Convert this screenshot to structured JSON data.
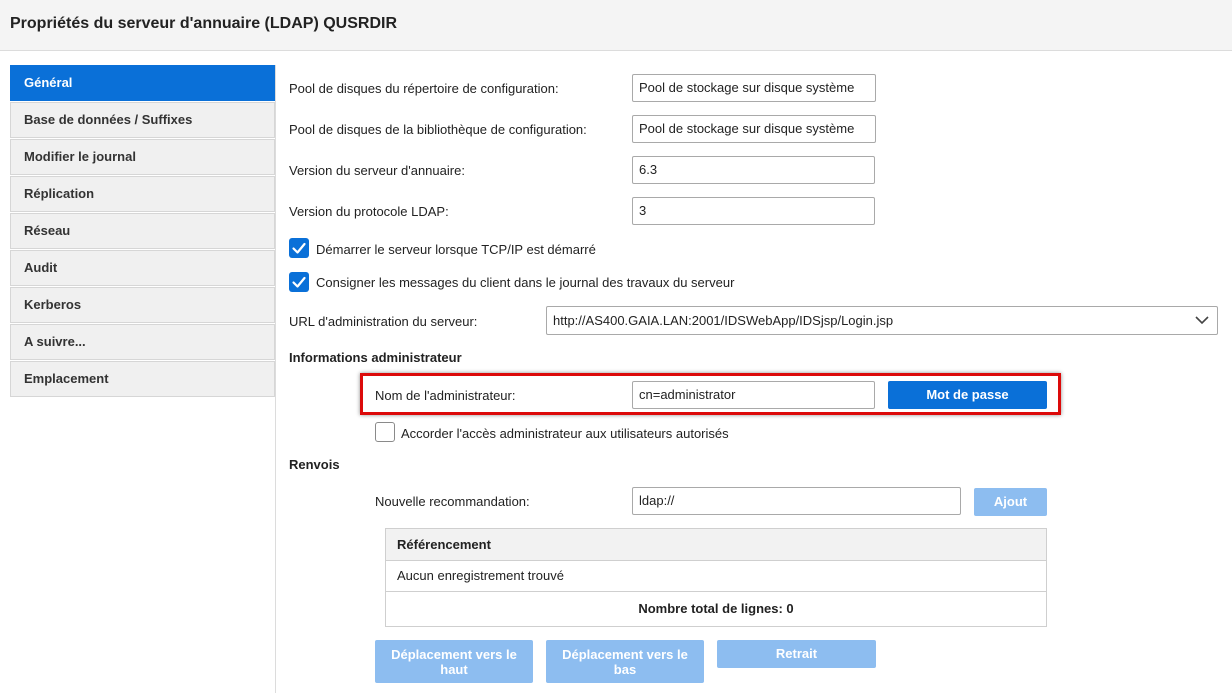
{
  "header": {
    "title": "Propriétés du serveur d'annuaire (LDAP) QUSRDIR"
  },
  "sidebar": {
    "items": [
      {
        "label": "Général",
        "active": true
      },
      {
        "label": "Base de données / Suffixes"
      },
      {
        "label": "Modifier le journal"
      },
      {
        "label": "Réplication"
      },
      {
        "label": "Réseau"
      },
      {
        "label": "Audit"
      },
      {
        "label": "Kerberos"
      },
      {
        "label": "A suivre..."
      },
      {
        "label": "Emplacement"
      }
    ]
  },
  "general": {
    "config_dir_pool": {
      "label": "Pool de disques du répertoire de configuration:",
      "value": "Pool de stockage sur disque système"
    },
    "config_lib_pool": {
      "label": "Pool de disques de la bibliothèque de configuration:",
      "value": "Pool de stockage sur disque système"
    },
    "server_version": {
      "label": "Version du serveur d'annuaire:",
      "value": "6.3"
    },
    "ldap_version": {
      "label": "Version du protocole LDAP:",
      "value": "3"
    },
    "start_with_tcpip": {
      "label": "Démarrer le serveur lorsque TCP/IP est démarré",
      "checked": true
    },
    "log_client_messages": {
      "label": "Consigner les messages du client dans le journal des travaux du serveur",
      "checked": true
    },
    "admin_url": {
      "label": "URL d'administration du serveur:",
      "value": "http://AS400.GAIA.LAN:2001/IDSWebApp/IDSjsp/Login.jsp"
    }
  },
  "admin": {
    "section_title": "Informations administrateur",
    "name_label": "Nom de l'administrateur:",
    "name_value": "cn=administrator",
    "password_button": "Mot de passe",
    "grant_access": {
      "label": "Accorder l'accès administrateur aux utilisateurs autorisés",
      "checked": false
    }
  },
  "referrals": {
    "section_title": "Renvois",
    "new_label": "Nouvelle recommandation:",
    "new_value": "ldap://",
    "add_button": "Ajout",
    "table": {
      "header": "Référencement",
      "empty": "Aucun enregistrement trouvé",
      "total": "Nombre total de lignes: 0"
    },
    "move_up_button": "Déplacement vers le haut",
    "move_down_button": "Déplacement vers le bas",
    "remove_button": "Retrait"
  },
  "colors": {
    "accent": "#0a70d8",
    "disabled": "#8dbdf0",
    "highlight": "#dc0a0a"
  }
}
